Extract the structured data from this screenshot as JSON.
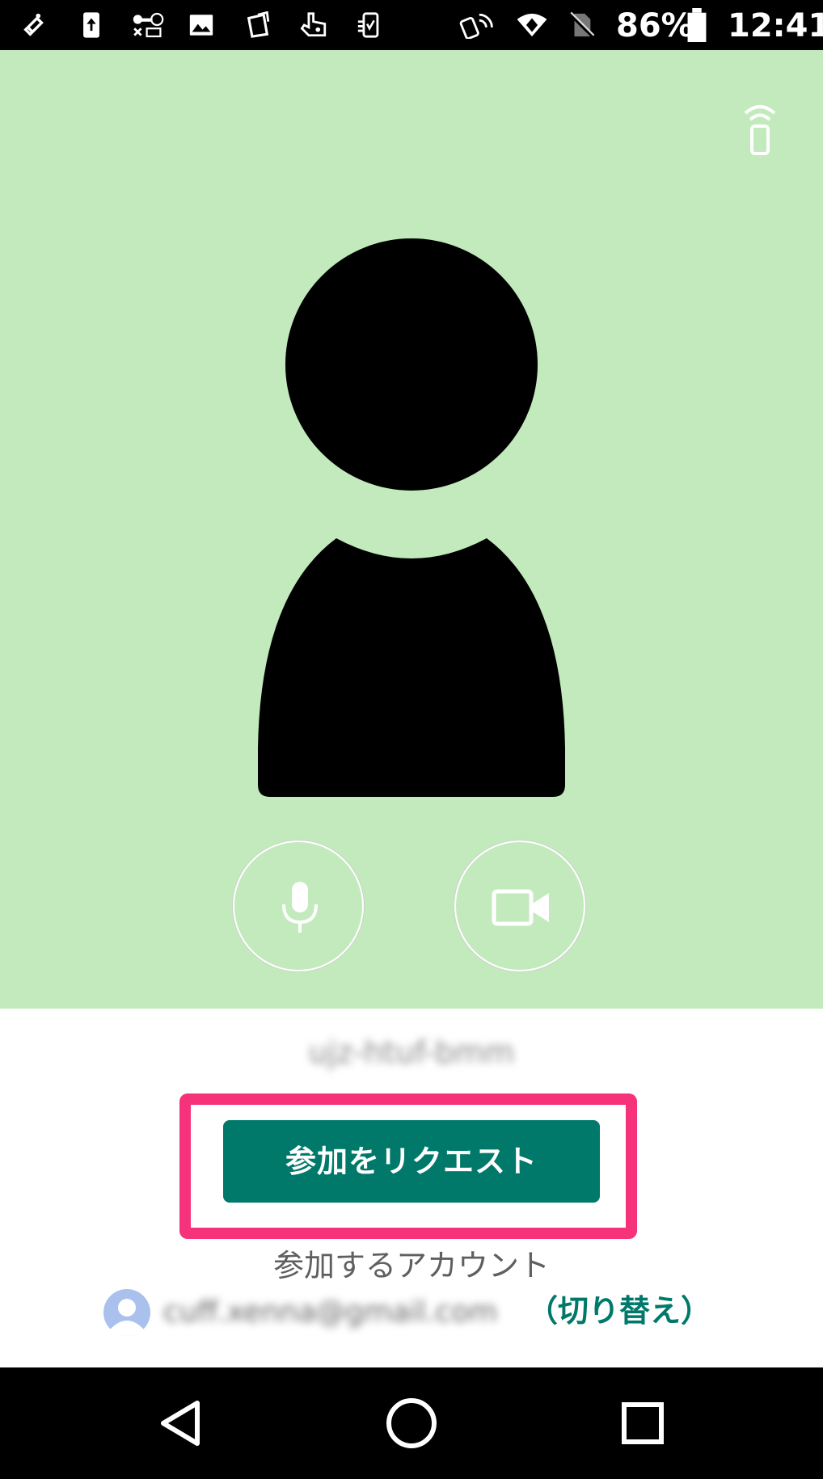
{
  "status_bar": {
    "battery_percent": "86%",
    "time": "12:41",
    "icons": [
      "notification-icon",
      "upload-icon",
      "vpn-key-icon",
      "gallery-icon",
      "app-icon",
      "gesture-icon",
      "phone-app-icon",
      "nfc-phone-icon",
      "wifi-icon",
      "no-sim-icon",
      "battery-icon"
    ]
  },
  "preview": {
    "background_color": "#c2eabc",
    "icons": [
      "cast-icon",
      "avatar-silhouette",
      "microphone-icon",
      "video-camera-icon"
    ]
  },
  "meeting": {
    "code": "ujz-htuf-bmm"
  },
  "join": {
    "button_label": "参加をリクエスト",
    "button_color": "#00796b",
    "highlight_color": "#f5327a"
  },
  "account": {
    "label": "参加するアカウント",
    "email": "cuff.xenna@gmail.com",
    "switch_label": "（切り替え）"
  },
  "nav_bar": {
    "icons": [
      "back-icon",
      "home-icon",
      "recents-icon"
    ]
  }
}
